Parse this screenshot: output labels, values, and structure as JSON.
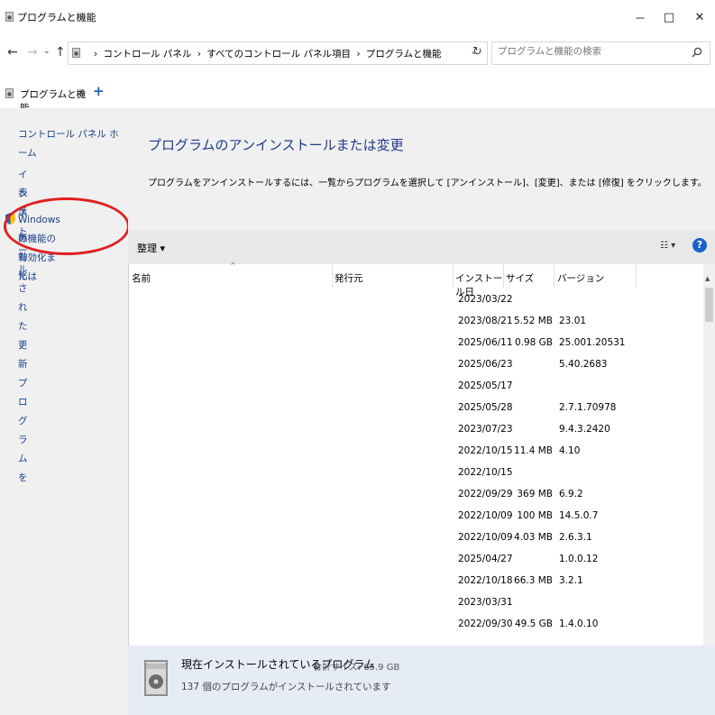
{
  "window": {
    "title": "プログラムと機能",
    "minimize": "－",
    "maximize": "□",
    "close": "✕"
  },
  "nav": {
    "back": "←",
    "forward": "→",
    "recent": "⌄",
    "up": "↑",
    "breadcrumbs": [
      "コントロール パネル",
      "すべてのコントロール パネル項目",
      "プログラムと機能"
    ],
    "dropdown": "⌄",
    "refresh": "↻"
  },
  "search": {
    "placeholder": "プログラムと機能の検索"
  },
  "tabs": [
    {
      "label": "プログラムと機能",
      "close": "x"
    }
  ],
  "new_tab": "+",
  "sidebar": {
    "items": [
      {
        "label": "コントロール パネル ホーム"
      },
      {
        "label_line1": "インストールされた更新プログラムを",
        "label_line2": "表示"
      },
      {
        "label_line1": "Windows の機能の有効化または",
        "label_line2": "無効化"
      }
    ]
  },
  "main": {
    "heading": "プログラムのアンインストールまたは変更",
    "description": "プログラムをアンインストールするには、一覧からプログラムを選択して [アンインストール]、[変更]、または [修復] をクリックします。",
    "toolbar": {
      "organize": "整理 ▾",
      "view": "☷ ▾",
      "help": "?"
    },
    "columns": {
      "name": "名前",
      "publisher": "発行元",
      "installed": "インストール日",
      "size": "サイズ",
      "version": "バージョン"
    },
    "rows": [
      {
        "date": "2023/03/22",
        "size": "",
        "version": ""
      },
      {
        "date": "2023/08/21",
        "size": "5.52 MB",
        "version": "23.01"
      },
      {
        "date": "2025/06/11",
        "size": "0.98 GB",
        "version": "25.001.20531"
      },
      {
        "date": "2025/06/23",
        "size": "",
        "version": "5.40.2683"
      },
      {
        "date": "2025/05/17",
        "size": "",
        "version": ""
      },
      {
        "date": "2025/05/28",
        "size": "",
        "version": "2.7.1.70978"
      },
      {
        "date": "2023/07/23",
        "size": "",
        "version": "9.4.3.2420"
      },
      {
        "date": "2022/10/15",
        "size": "11.4 MB",
        "version": "4.10"
      },
      {
        "date": "2022/10/15",
        "size": "",
        "version": ""
      },
      {
        "date": "2022/09/29",
        "size": "369 MB",
        "version": "6.9.2"
      },
      {
        "date": "2022/10/09",
        "size": "100 MB",
        "version": "14.5.0.7"
      },
      {
        "date": "2022/10/09",
        "size": "4.03 MB",
        "version": "2.6.3.1"
      },
      {
        "date": "2025/04/27",
        "size": "",
        "version": "1.0.0.12"
      },
      {
        "date": "2022/10/18",
        "size": "66.3 MB",
        "version": "3.2.1"
      },
      {
        "date": "2023/03/31",
        "size": "",
        "version": ""
      },
      {
        "date": "2022/09/30",
        "size": "49.5 GB",
        "version": "1.4.0.10"
      }
    ]
  },
  "details": {
    "label": "現在インストールされているプログラム",
    "total": "合計サイズ:  65.9 GB",
    "count": "137 個のプログラムがインストールされています"
  },
  "colors": {
    "link": "#1a3f8a",
    "heading": "#1e3a8a",
    "accent": "#1662c8",
    "annotation": "#e02020",
    "sidebar_bg": "#f0f0f0",
    "details_bg": "#e6ecf5"
  }
}
